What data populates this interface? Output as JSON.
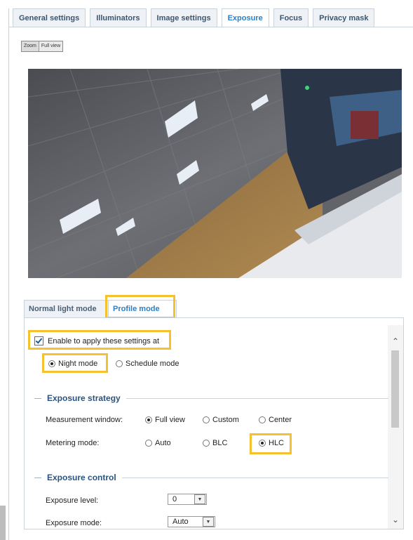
{
  "top_tabs": [
    "General settings",
    "Illuminators",
    "Image settings",
    "Exposure",
    "Focus",
    "Privacy mask"
  ],
  "toolbar": {
    "btn1": "Zoom",
    "btn2": "Full view"
  },
  "camera": {
    "label": "Live camera view"
  },
  "mode_tabs": {
    "normal": "Normal light mode",
    "profile": "Profile mode"
  },
  "enable": {
    "label": "Enable to apply these settings at"
  },
  "modes": {
    "night": "Night mode",
    "schedule": "Schedule mode"
  },
  "exposure_strategy": {
    "title": "Exposure strategy",
    "measurement_label": "Measurement window:",
    "measurement_options": [
      "Full view",
      "Custom",
      "Center"
    ],
    "metering_label": "Metering mode:",
    "metering_options": [
      "Auto",
      "BLC",
      "HLC"
    ]
  },
  "exposure_control": {
    "title": "Exposure control",
    "level_label": "Exposure level:",
    "level_value": "0",
    "mode_label": "Exposure mode:",
    "mode_value": "Auto"
  },
  "colors": {
    "accent": "#2a7fc9",
    "highlight": "#f5c12e",
    "section_title": "#29547f"
  }
}
